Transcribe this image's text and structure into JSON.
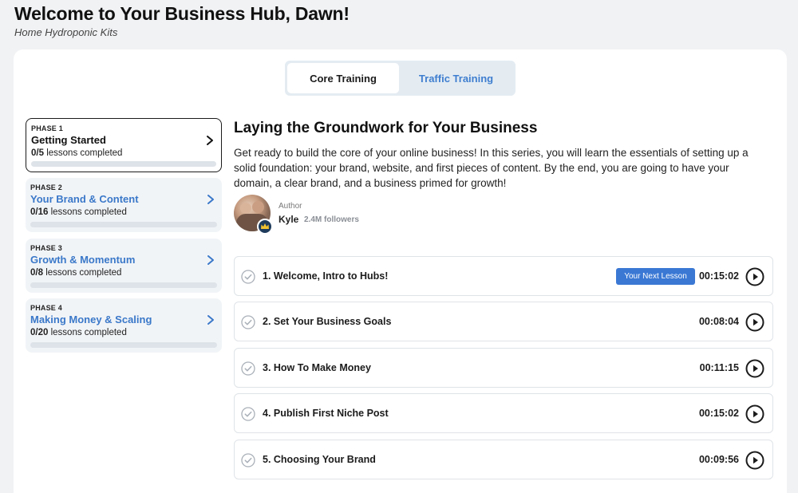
{
  "header": {
    "title": "Welcome to Your Business Hub, Dawn!",
    "subtitle": "Home Hydroponic Kits"
  },
  "tabs": [
    {
      "label": "Core Training",
      "active": true
    },
    {
      "label": "Traffic Training",
      "active": false
    }
  ],
  "phases": [
    {
      "label": "PHASE 1",
      "name": "Getting Started",
      "completed": "0/5",
      "suffix": "lessons completed",
      "progress": 0,
      "active": true
    },
    {
      "label": "PHASE 2",
      "name": "Your Brand & Content",
      "completed": "0/16",
      "suffix": "lessons completed",
      "progress": 0,
      "active": false
    },
    {
      "label": "PHASE 3",
      "name": "Growth & Momentum",
      "completed": "0/8",
      "suffix": "lessons completed",
      "progress": 0,
      "active": false
    },
    {
      "label": "PHASE 4",
      "name": "Making Money & Scaling",
      "completed": "0/20",
      "suffix": "lessons completed",
      "progress": 0,
      "active": false
    }
  ],
  "series": {
    "title": "Laying the Groundwork for Your Business",
    "description": "Get ready to build the core of your online business! In this series, you will learn the essentials of setting up a solid foundation: your brand, website, and first pieces of content. By the end, you are going to have your domain, a clear brand, and a business primed for growth!"
  },
  "author": {
    "label": "Author",
    "name": "Kyle",
    "followers": "2.4M followers"
  },
  "lessons": [
    {
      "title": "1. Welcome, Intro to Hubs!",
      "badge": "Your Next Lesson",
      "duration": "00:15:02"
    },
    {
      "title": "2. Set Your Business Goals",
      "badge": "",
      "duration": "00:08:04"
    },
    {
      "title": "3. How To Make Money",
      "badge": "",
      "duration": "00:11:15"
    },
    {
      "title": "4. Publish First Niche Post",
      "badge": "",
      "duration": "00:15:02"
    },
    {
      "title": "5. Choosing Your Brand",
      "badge": "",
      "duration": "00:09:56"
    }
  ],
  "icons": {
    "phase_chevron": "chevron-right-icon",
    "lesson_status": "check-circle-icon",
    "lesson_play": "play-circle-icon",
    "author_badge": "crown-icon"
  },
  "colors": {
    "accent": "#3a78d4",
    "link": "#3a78c9",
    "crown_badge": "#1f3b5c",
    "crown": "#f2c230"
  }
}
